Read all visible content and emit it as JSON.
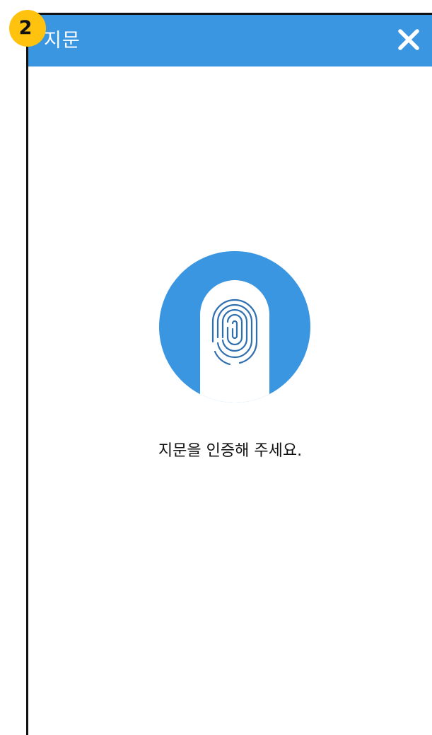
{
  "step_badge": "2",
  "header": {
    "title": "지문",
    "close_icon": "close-icon"
  },
  "main": {
    "illustration_icon": "fingerprint-icon",
    "instruction": "지문을 인증해 주세요."
  },
  "colors": {
    "header_bg": "#3b96e1",
    "badge": "#ffc20e",
    "fingerprint_line": "#2f6fb0"
  }
}
